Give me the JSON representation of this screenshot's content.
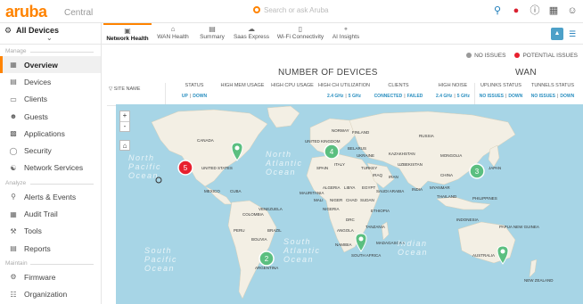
{
  "app": {
    "logo": "aruba",
    "product": "Central",
    "search_placeholder": "Search or ask Aruba"
  },
  "sidebar": {
    "scope": "All Devices",
    "sections": {
      "manage": "Manage",
      "analyze": "Analyze",
      "maintain": "Maintain"
    },
    "manage_items": [
      {
        "label": "Overview",
        "icon": "overview-icon",
        "active": true
      },
      {
        "label": "Devices",
        "icon": "devices-icon"
      },
      {
        "label": "Clients",
        "icon": "clients-icon"
      },
      {
        "label": "Guests",
        "icon": "guests-icon"
      },
      {
        "label": "Applications",
        "icon": "applications-icon"
      },
      {
        "label": "Security",
        "icon": "security-icon"
      },
      {
        "label": "Network Services",
        "icon": "network-services-icon"
      }
    ],
    "analyze_items": [
      {
        "label": "Alerts & Events",
        "icon": "bell-icon"
      },
      {
        "label": "Audit Trail",
        "icon": "audit-icon"
      },
      {
        "label": "Tools",
        "icon": "tools-icon"
      },
      {
        "label": "Reports",
        "icon": "reports-icon"
      }
    ],
    "maintain_items": [
      {
        "label": "Firmware",
        "icon": "firmware-icon"
      },
      {
        "label": "Organization",
        "icon": "organization-icon"
      }
    ]
  },
  "tabs": [
    {
      "label": "Network Health",
      "active": true
    },
    {
      "label": "WAN Health"
    },
    {
      "label": "Summary"
    },
    {
      "label": "Saas Express"
    },
    {
      "label": "Wi-Fi Connectivity"
    },
    {
      "label": "AI Insights"
    }
  ],
  "legend": {
    "no_issues": "NO ISSUES",
    "potential_issues": "POTENTIAL ISSUES",
    "no_issues_color": "#999999",
    "potential_color": "#e8202e"
  },
  "groups": {
    "devices": "NUMBER OF DEVICES",
    "wan": "WAN"
  },
  "columns": {
    "site_name": "SITE NAME",
    "status": {
      "label": "STATUS",
      "a": "UP",
      "b": "DOWN"
    },
    "mem": "HIGH MEM USAGE",
    "cpu": "HIGH CPU USAGE",
    "ch_util": {
      "label": "HIGH CH UTILIZATION",
      "a": "2.4 GHz",
      "b": "5 GHz"
    },
    "clients": {
      "label": "CLIENTS",
      "a": "CONNECTED",
      "b": "FAILED"
    },
    "noise": {
      "label": "HIGH NOISE",
      "a": "2.4 GHz",
      "b": "5 GHz"
    },
    "uplinks": {
      "label": "UPLINKS STATUS",
      "a": "NO ISSUES",
      "b": "DOWN"
    },
    "tunnels": {
      "label": "TUNNELS STATUS",
      "a": "NO ISSUES",
      "b": "DOWN"
    }
  },
  "map": {
    "zoom_in": "+",
    "zoom_out": "-",
    "markers": [
      {
        "count": "5",
        "status": "potential"
      },
      {
        "count": "4",
        "status": "ok"
      },
      {
        "count": "3",
        "status": "ok"
      },
      {
        "count": "2",
        "status": "ok"
      }
    ],
    "oceans": {
      "north_pacific_1": "North",
      "north_pacific_2": "Pacific",
      "north_pacific_3": "Ocean",
      "north_atlantic_1": "North",
      "north_atlantic_2": "Atlantic",
      "north_atlantic_3": "Ocean",
      "south_pacific_1": "South",
      "south_pacific_2": "Pacific",
      "south_pacific_3": "Ocean",
      "south_atlantic_1": "South",
      "south_atlantic_2": "Atlantic",
      "south_atlantic_3": "Ocean",
      "indian_1": "Indian",
      "indian_2": "Ocean"
    },
    "labels": {
      "canada": "CANADA",
      "us": "UNITED STATES",
      "mexico": "MEXICO",
      "cuba": "CUBA",
      "colombia": "COLOMBIA",
      "venezuela": "VENEZUELA",
      "peru": "PERU",
      "brazil": "BRAZIL",
      "bolivia": "BOLIVIA",
      "argentina": "ARGENTINA",
      "uk": "UNITED KINGDOM",
      "norway": "NORWAY",
      "finland": "FINLAND",
      "russia": "RUSSIA",
      "belarus": "BELARUS",
      "ukraine": "UKRAINE",
      "spain": "SPAIN",
      "italy": "ITALY",
      "turkey": "TURKEY",
      "kazakhstan": "KAZAKHSTAN",
      "mongolia": "MONGOLIA",
      "uzbekistan": "UZBEKISTAN",
      "china": "CHINA",
      "japan": "JAPAN",
      "iran": "IRAN",
      "iraq": "IRAQ",
      "algeria": "ALGERIA",
      "libya": "LIBYA",
      "egypt": "EGYPT",
      "saudi": "SAUDI ARABIA",
      "india": "INDIA",
      "myanmar": "MYANMAR",
      "thailand": "THAILAND",
      "philippines": "PHILIPPINES",
      "mali": "MALI",
      "niger": "NIGER",
      "chad": "CHAD",
      "sudan": "SUDAN",
      "nigeria": "NIGERIA",
      "ethiopia": "ETHIOPIA",
      "drc": "DRC",
      "tanzania": "TANZANIA",
      "angola": "ANGOLA",
      "namibia": "NAMIBIA",
      "south_africa": "SOUTH AFRICA",
      "madagascar": "MADAGASCAR",
      "indonesia": "INDONESIA",
      "png": "PAPUA NEW GUINEA",
      "australia": "AUSTRALIA",
      "new_zealand": "NEW ZEALAND",
      "mauritania": "MAURITANIA"
    },
    "land_color": "#f3efe4",
    "water_color": "#a7d5e6",
    "marker_ok": "#5bbf80",
    "marker_bad": "#e8202e"
  }
}
